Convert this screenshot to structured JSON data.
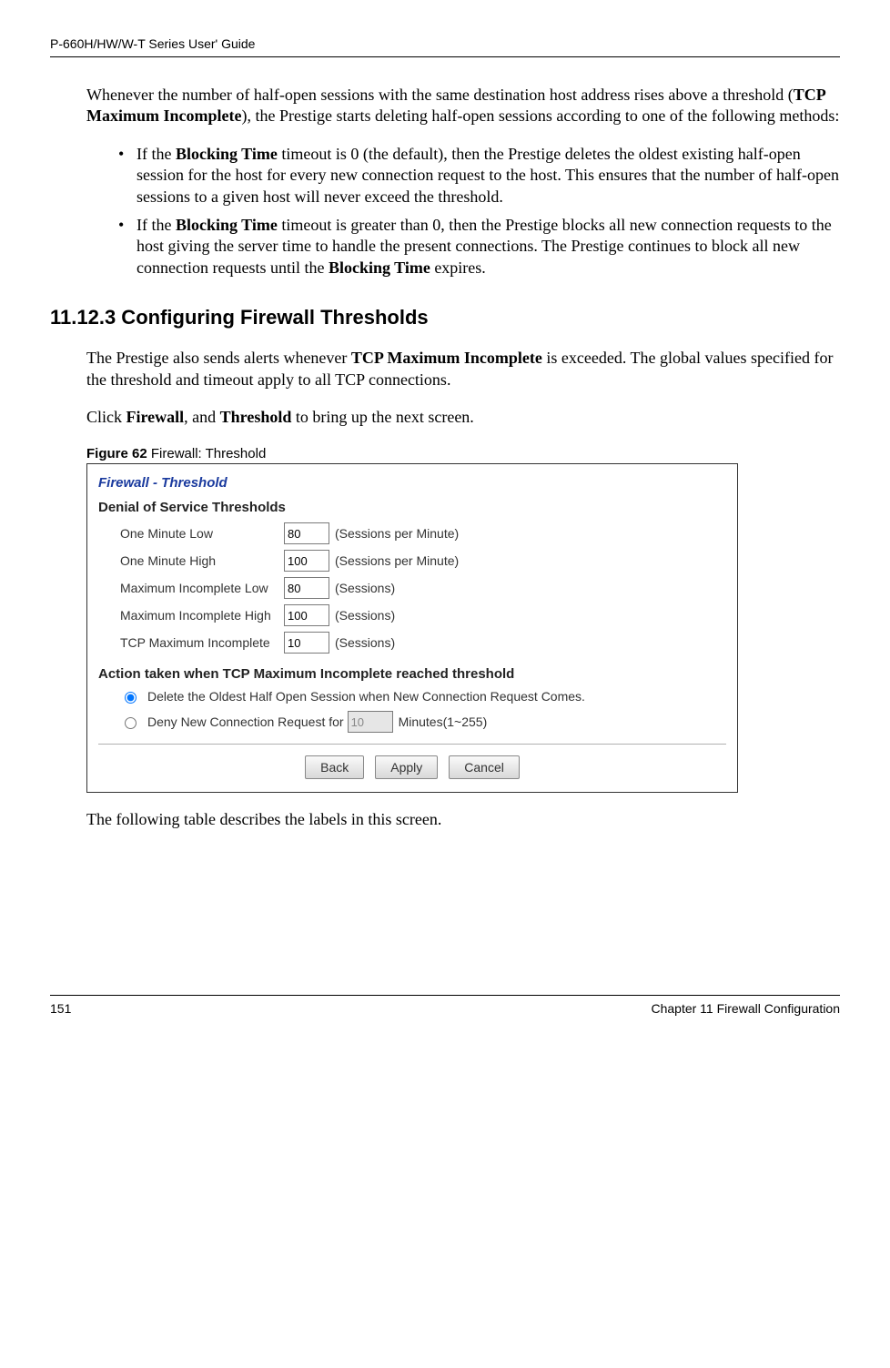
{
  "header": {
    "title": "P-660H/HW/W-T Series User' Guide"
  },
  "para1_part1": "Whenever the number of half-open sessions with the same destination host address rises above a threshold (",
  "para1_bold1": "TCP Maximum Incomplete",
  "para1_part2": "), the Prestige starts deleting half-open sessions according to one of the following methods:",
  "bullet1_p1": "If the ",
  "bullet1_b1": "Blocking Time",
  "bullet1_p2": " timeout is 0 (the default), then the Prestige deletes the oldest existing half-open session for the host for every new connection request to the host. This ensures that the number of half-open sessions to a given host will never exceed the threshold.",
  "bullet2_p1": "If the ",
  "bullet2_b1": "Blocking Time",
  "bullet2_p2": " timeout is greater than 0, then the Prestige blocks all new connection requests to the host giving the server time to handle the present connections. The Prestige continues to block all new connection requests until the ",
  "bullet2_b2": "Blocking Time",
  "bullet2_p3": " expires.",
  "section_heading": "11.12.3  Configuring Firewall Thresholds",
  "para2_p1": "The Prestige also sends alerts whenever ",
  "para2_b1": "TCP Maximum Incomplete",
  "para2_p2": " is exceeded. The global values specified for the threshold and timeout apply to all TCP connections.",
  "para3_p1": "Click ",
  "para3_b1": "Firewall",
  "para3_p2": ", and ",
  "para3_b2": "Threshold",
  "para3_p3": " to bring up the next screen.",
  "figure_label": "Figure 62",
  "figure_caption": "   Firewall: Threshold",
  "screenshot": {
    "title": "Firewall - Threshold",
    "dos_heading": "Denial of Service Thresholds",
    "rows": [
      {
        "label": "One Minute Low",
        "value": "80",
        "unit": "(Sessions per Minute)"
      },
      {
        "label": "One Minute High",
        "value": "100",
        "unit": "(Sessions per Minute)"
      },
      {
        "label": "Maximum Incomplete Low",
        "value": "80",
        "unit": "(Sessions)"
      },
      {
        "label": "Maximum Incomplete High",
        "value": "100",
        "unit": "(Sessions)"
      },
      {
        "label": "TCP Maximum Incomplete",
        "value": "10",
        "unit": "(Sessions)"
      }
    ],
    "action_heading": "Action taken when TCP Maximum Incomplete reached threshold",
    "action1": "Delete the Oldest Half Open Session when New Connection Request Comes.",
    "action2_p1": "Deny New Connection Request for ",
    "action2_value": "10",
    "action2_p2": " Minutes(1~255)",
    "buttons": {
      "back": "Back",
      "apply": "Apply",
      "cancel": "Cancel"
    }
  },
  "para4": "The following table describes the labels in this screen.",
  "footer": {
    "page": "151",
    "chapter": "Chapter 11 Firewall Configuration"
  }
}
